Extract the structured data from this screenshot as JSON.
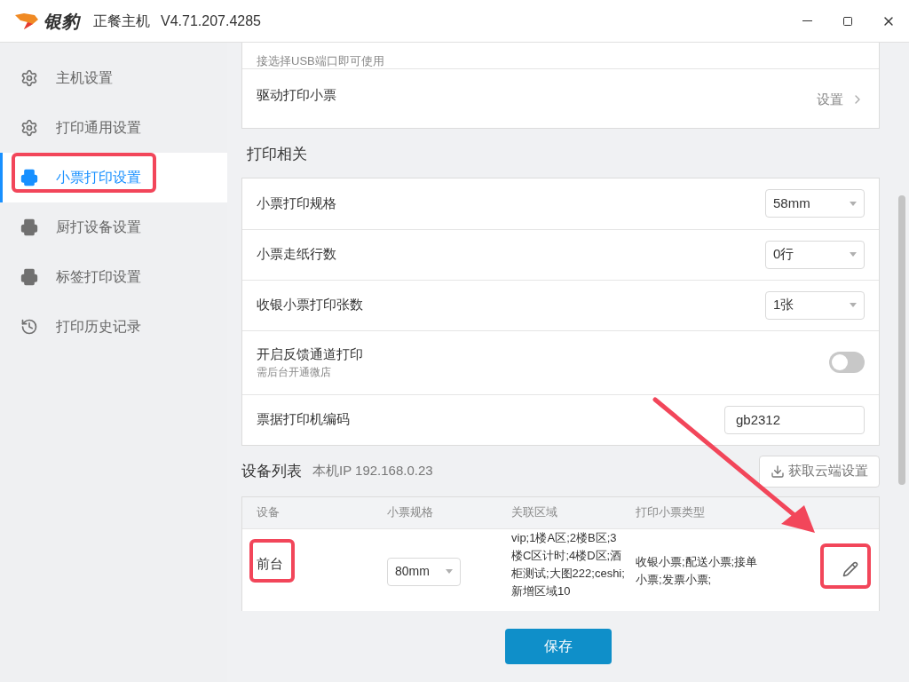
{
  "title_bar": {
    "logo": "银豹",
    "product": "正餐主机",
    "version": "V4.71.207.4285"
  },
  "sidebar": {
    "items": [
      {
        "label": "主机设置",
        "kind": "gear",
        "selected": false
      },
      {
        "label": "打印通用设置",
        "kind": "gear",
        "selected": false
      },
      {
        "label": "小票打印设置",
        "kind": "printer",
        "selected": true
      },
      {
        "label": "厨打设备设置",
        "kind": "printer",
        "selected": false
      },
      {
        "label": "标签打印设置",
        "kind": "printer",
        "selected": false
      },
      {
        "label": "打印历史记录",
        "kind": "history",
        "selected": false
      }
    ]
  },
  "usb_card": {
    "hint": "接选择USB端口即可使用",
    "driver_row": {
      "label": "驱动打印小票",
      "action": "设置"
    }
  },
  "print_section": {
    "title": "打印相关",
    "rows": [
      {
        "kind": "select",
        "label": "小票打印规格",
        "value": "58mm"
      },
      {
        "kind": "select",
        "label": "小票走纸行数",
        "value": "0行"
      },
      {
        "kind": "select",
        "label": "收银小票打印张数",
        "value": "1张"
      },
      {
        "kind": "switch",
        "label": "开启反馈通道打印",
        "sublabel": "需后台开通微店",
        "on": false
      },
      {
        "kind": "input",
        "label": "票据打印机编码",
        "value": "gb2312"
      }
    ]
  },
  "devices": {
    "title": "设备列表",
    "ip": "本机IP 192.168.0.23",
    "fetch_button": "获取云端设置",
    "columns": [
      "设备",
      "小票规格",
      "关联区域",
      "打印小票类型"
    ],
    "rows": [
      {
        "device": "前台",
        "size": "80mm",
        "areas": "vip;1楼A区;2楼B区;3楼C区计时;4楼D区;酒柜测试;大图222;ceshi;新增区域10",
        "types": "收银小票;配送小票;接单小票;发票小票;"
      }
    ]
  },
  "save_button": "保存"
}
